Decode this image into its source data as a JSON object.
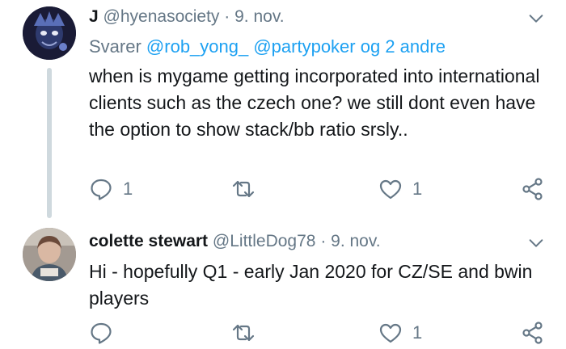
{
  "tweets": [
    {
      "name": "J",
      "handle": "@hyenasociety",
      "separator": "·",
      "date": "9. nov.",
      "reply_prefix": "Svarer",
      "reply_mentions": "@rob_yong_ @partypoker",
      "reply_suffix": "og 2 andre",
      "text": "when is mygame getting incorporated into international clients such as the czech one? we still dont even have the option to show stack/bb ratio srsly..",
      "reply_count": "1",
      "retweet_count": "",
      "like_count": "1"
    },
    {
      "name": "colette stewart",
      "handle": "@LittleDog78",
      "separator": "·",
      "date": "9. nov.",
      "text": "Hi - hopefully Q1 - early Jan 2020 for CZ/SE and bwin players",
      "reply_count": "",
      "retweet_count": "",
      "like_count": "1"
    }
  ],
  "icons": [
    "chevron-down-icon",
    "reply-icon",
    "retweet-icon",
    "like-icon",
    "share-icon"
  ],
  "colors": {
    "text": "#14171a",
    "secondary": "#657786",
    "link": "#1da1f2",
    "thread_line": "#cfd9de"
  }
}
